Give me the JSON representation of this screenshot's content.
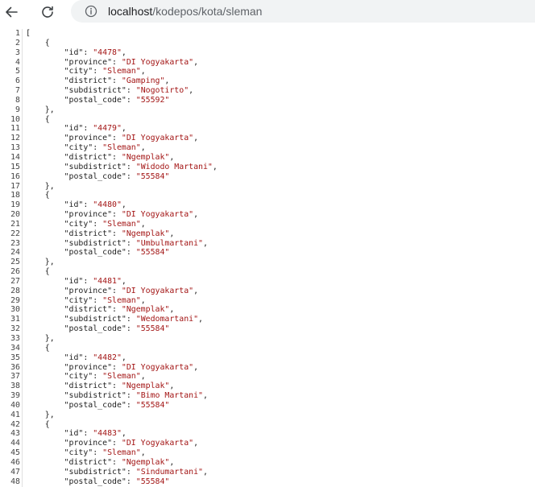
{
  "browser": {
    "url_host": "localhost",
    "url_path": "/kodepos/kota/sleman"
  },
  "viewer": {
    "records": [
      {
        "id": "4478",
        "province": "DI Yogyakarta",
        "city": "Sleman",
        "district": "Gamping",
        "subdistrict": "Nogotirto",
        "postal_code": "55592"
      },
      {
        "id": "4479",
        "province": "DI Yogyakarta",
        "city": "Sleman",
        "district": "Ngemplak",
        "subdistrict": "Widodo Martani",
        "postal_code": "55584"
      },
      {
        "id": "4480",
        "province": "DI Yogyakarta",
        "city": "Sleman",
        "district": "Ngemplak",
        "subdistrict": "Umbulmartani",
        "postal_code": "55584"
      },
      {
        "id": "4481",
        "province": "DI Yogyakarta",
        "city": "Sleman",
        "district": "Ngemplak",
        "subdistrict": "Wedomartani",
        "postal_code": "55584"
      },
      {
        "id": "4482",
        "province": "DI Yogyakarta",
        "city": "Sleman",
        "district": "Ngemplak",
        "subdistrict": "Bimo Martani",
        "postal_code": "55584"
      },
      {
        "id": "4483",
        "province": "DI Yogyakarta",
        "city": "Sleman",
        "district": "Ngemplak",
        "subdistrict": "Sindumartani",
        "postal_code": "55584"
      }
    ]
  }
}
